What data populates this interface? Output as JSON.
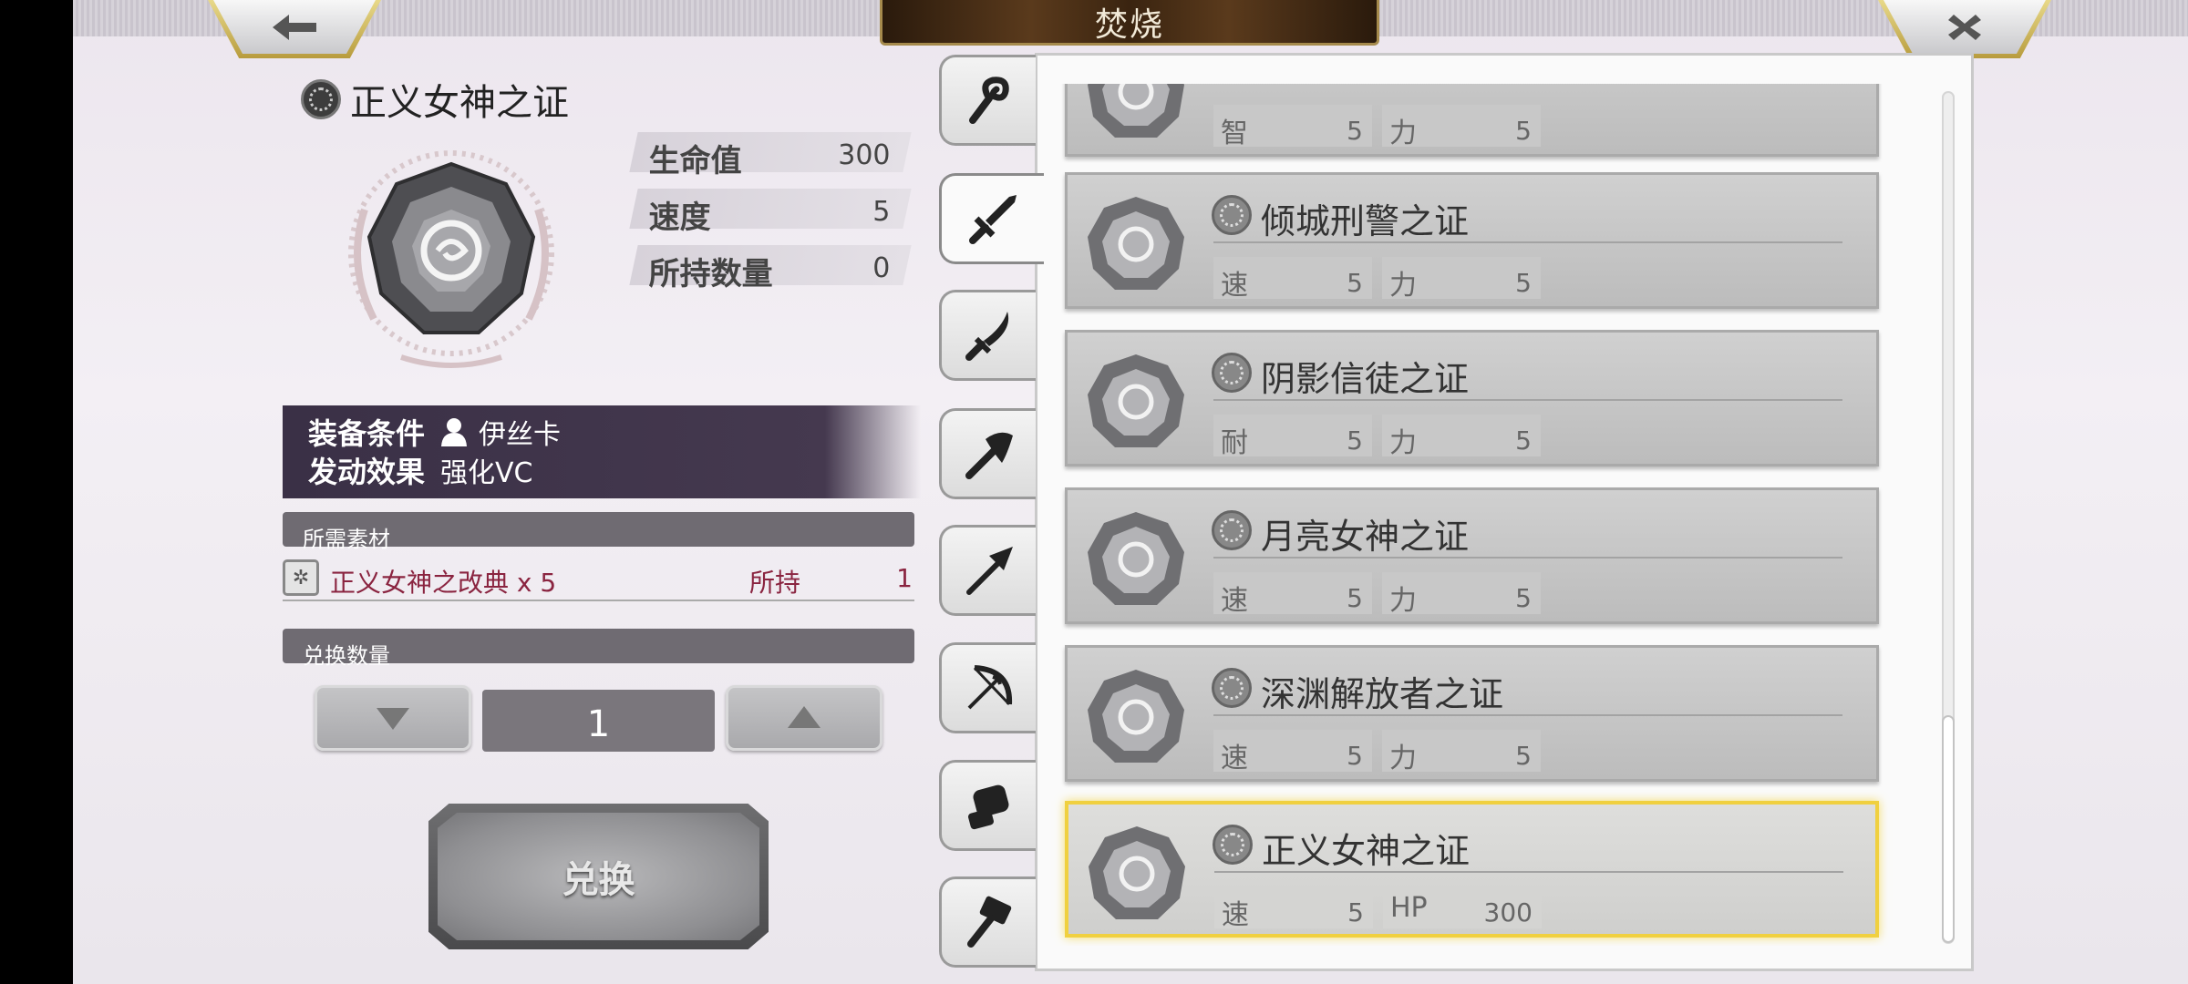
{
  "header": {
    "title": "焚烧",
    "back_icon": "arrow-left-icon",
    "close_icon": "close-icon"
  },
  "item": {
    "name": "正义女神之证",
    "stats": [
      {
        "label": "生命值",
        "value": "300"
      },
      {
        "label": "速度",
        "value": "5"
      },
      {
        "label": "所持数量",
        "value": "0"
      }
    ],
    "conditions": {
      "equip_label": "装备条件",
      "equip_value": "伊丝卡",
      "effect_label": "发动效果",
      "effect_value": "强化VC"
    }
  },
  "materials": {
    "header": "所需素材",
    "name": "正义女神之改典 x 5",
    "own_label": "所持",
    "own_count": "1"
  },
  "exchange": {
    "header": "兑换数量",
    "quantity": "1",
    "button_label": "兑换"
  },
  "tabs": [
    "staff-icon",
    "sword-icon",
    "blade-icon",
    "axe-icon",
    "spear-icon",
    "bow-icon",
    "gauntlet-icon",
    "hammer-icon"
  ],
  "list": [
    {
      "name": "",
      "stats": [
        {
          "k": "智",
          "v": "5"
        },
        {
          "k": "力",
          "v": "5"
        }
      ]
    },
    {
      "name": "倾城刑警之证",
      "stats": [
        {
          "k": "速",
          "v": "5"
        },
        {
          "k": "力",
          "v": "5"
        }
      ]
    },
    {
      "name": "阴影信徒之证",
      "stats": [
        {
          "k": "耐",
          "v": "5"
        },
        {
          "k": "力",
          "v": "5"
        }
      ]
    },
    {
      "name": "月亮女神之证",
      "stats": [
        {
          "k": "速",
          "v": "5"
        },
        {
          "k": "力",
          "v": "5"
        }
      ]
    },
    {
      "name": "深渊解放者之证",
      "stats": [
        {
          "k": "速",
          "v": "5"
        },
        {
          "k": "力",
          "v": "5"
        }
      ]
    },
    {
      "name": "正义女神之证",
      "stats": [
        {
          "k": "速",
          "v": "5"
        },
        {
          "k": "HP",
          "v": "300"
        }
      ]
    }
  ],
  "colors": {
    "accent_gold": "#f0d040",
    "material_text": "#8a2440",
    "condition_bg": "#3a3046"
  }
}
